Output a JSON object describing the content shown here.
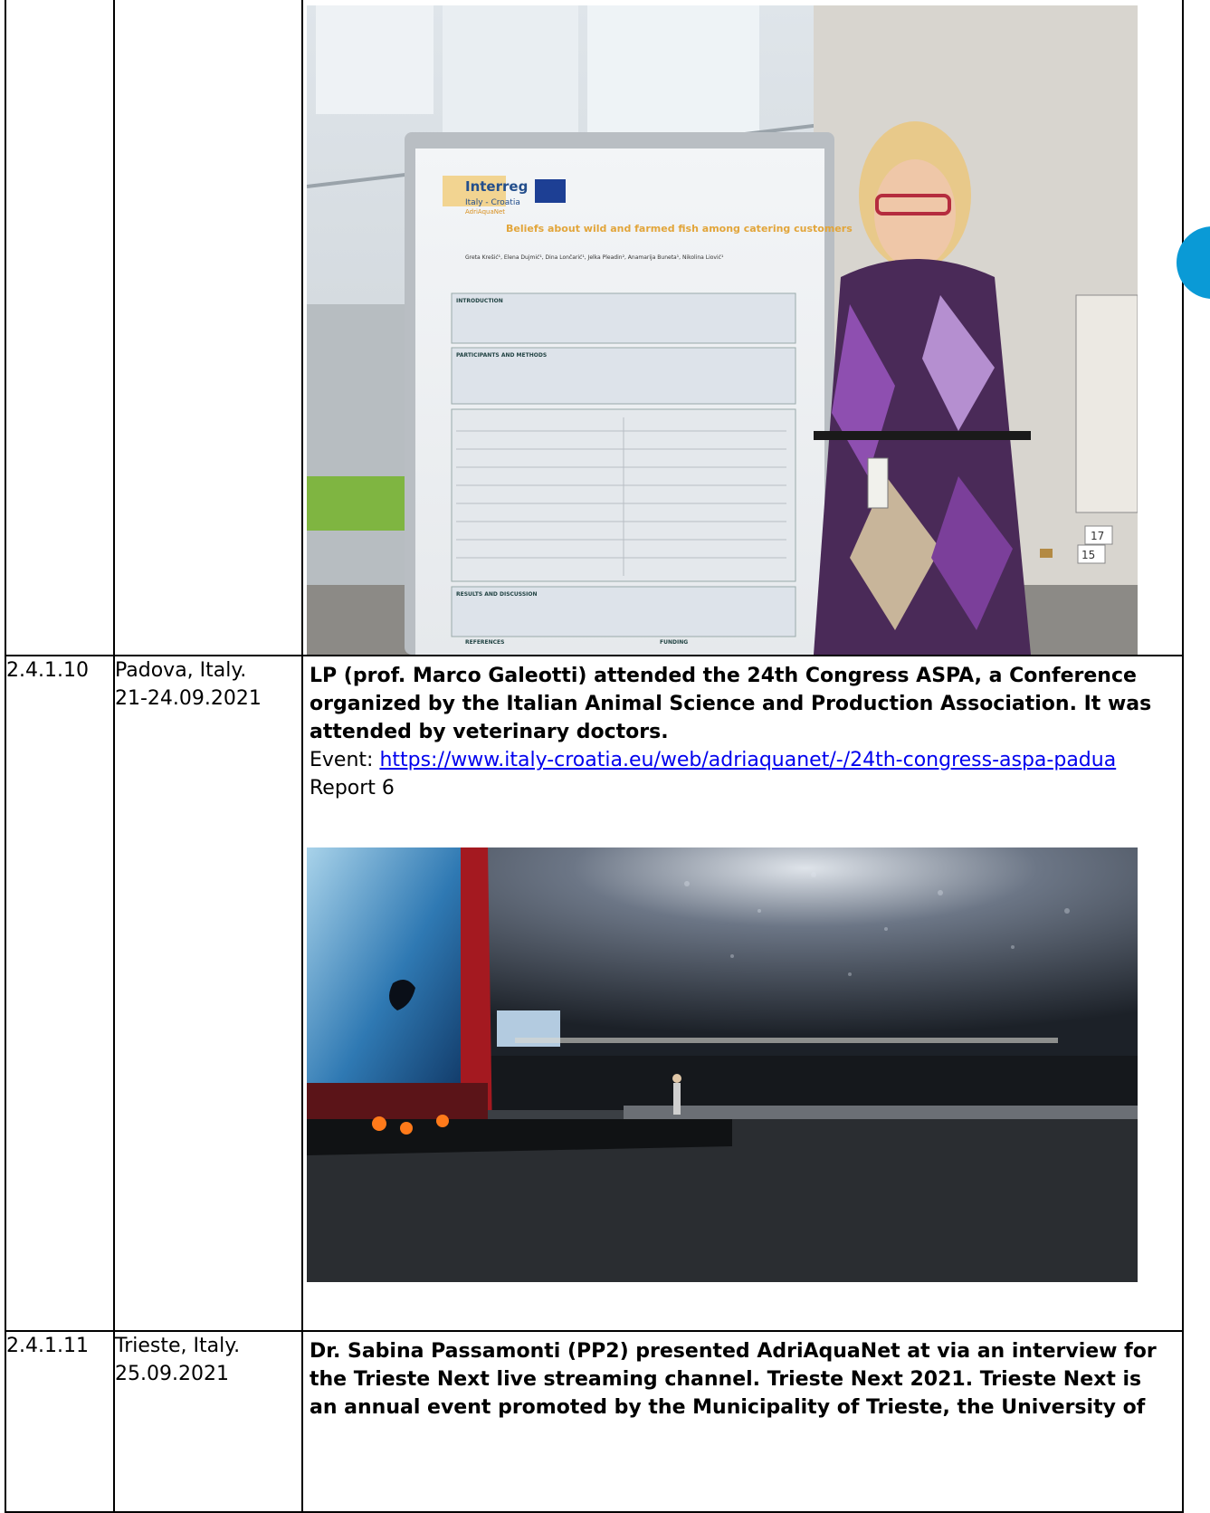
{
  "rows": [
    {
      "id": "",
      "place": "",
      "date": "",
      "photo": {
        "poster_logo": "Interreg",
        "poster_logo_sub": "Italy - Croatia",
        "poster_project": "AdriAquaNet",
        "poster_title": "Beliefs about wild and farmed fish among catering customers",
        "poster_authors": "Greta Krešić¹, Elena Dujmić¹, Dina Lončarić¹, Jelka Pleadin², Anamarija Buneta¹, Nikolina Liović¹",
        "poster_sections": [
          "INTRODUCTION",
          "PARTICIPANTS AND METHODS",
          "RESULTS AND DISCUSSION",
          "REFERENCES",
          "FUNDING"
        ],
        "sign_numbers": [
          "17",
          "15"
        ]
      }
    },
    {
      "id": "2.4.1.10",
      "place": "Padova, Italy.",
      "date": "21-24.09.2021",
      "text_bold": "LP (prof. Marco Galeotti) attended the 24th Congress ASPA, a Conference organized by the Italian Animal Science and Production Association. It was attended by veterinary doctors.",
      "event_label": "Event: ",
      "event_link": "https://www.italy-croatia.eu/web/adriaquanet/-/24th-congress-aspa-padua",
      "report": "Report 6"
    },
    {
      "id": "2.4.1.11",
      "place": "Trieste, Italy.",
      "date": "25.09.2021",
      "text_bold": "Dr. Sabina Passamonti (PP2) presented AdriAquaNet at via an interview for the Trieste Next live streaming channel. Trieste Next 2021. Trieste Next is an annual event promoted by the Municipality of Trieste, the University of"
    }
  ],
  "colors": {
    "link": "#0000ee",
    "border": "#000000",
    "side_badge": "#0a9ad6"
  }
}
